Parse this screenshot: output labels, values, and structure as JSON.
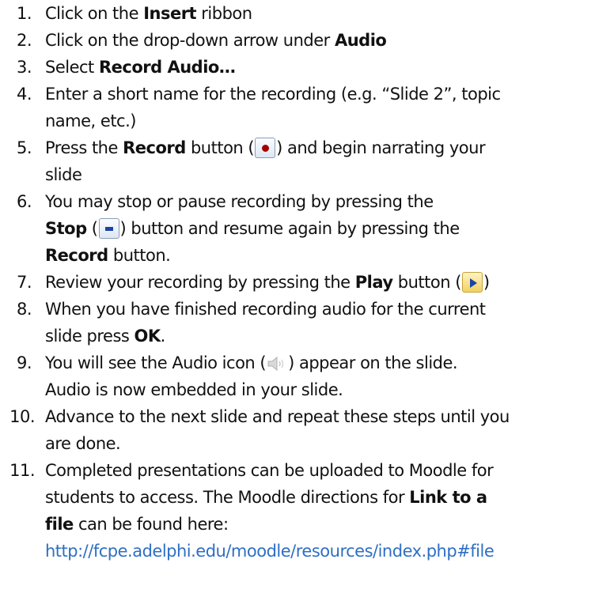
{
  "steps": [
    {
      "num": "1.",
      "pre": "Click on the ",
      "bold": "Insert",
      "post": " ribbon"
    },
    {
      "num": "2.",
      "pre": "Click on the drop-down arrow under ",
      "bold": "Audio"
    },
    {
      "num": "3.",
      "pre": "Select ",
      "bold": "Record Audio…"
    },
    {
      "num": "4.",
      "line1": "Enter a short name for the recording (e.g. “Slide 2”, topic",
      "line2": "name, etc.)"
    },
    {
      "num": "5.",
      "pre": "Press the ",
      "bold": "Record",
      "mid": " button (",
      "post": ") and begin narrating your",
      "line2": "slide",
      "icon": "record-button-icon"
    },
    {
      "num": "6.",
      "line1": "You may stop or pause recording by pressing the",
      "bold": "Stop",
      "mid": " (",
      "post": ") button and resume again by pressing the",
      "bold2": "Record",
      "post2": " button.",
      "icon": "stop-button-icon"
    },
    {
      "num": "7.",
      "pre": "Review your recording by pressing the ",
      "bold": "Play",
      "mid": " button (",
      "post": ")",
      "icon": "play-button-icon"
    },
    {
      "num": "8.",
      "line1": "When you have finished recording audio for the current",
      "pre": "slide press ",
      "bold": "OK",
      "post": "."
    },
    {
      "num": "9.",
      "pre": "You will see the Audio icon (",
      "post": ") appear on the slide.",
      "line2": "Audio is now embedded in your slide.",
      "icon": "speaker-icon"
    },
    {
      "num": "10.",
      "line1": "Advance to the next slide and repeat these steps until you",
      "line2": "are done."
    },
    {
      "num": "11.",
      "line1": "Completed presentations can be uploaded to Moodle for",
      "pre": "students to access. The Moodle directions for ",
      "bold": "Link to a",
      "bold2": "file",
      "post2": " can be found here:",
      "link": "http://fcpe.adelphi.edu/moodle/resources/index.php#file"
    }
  ]
}
